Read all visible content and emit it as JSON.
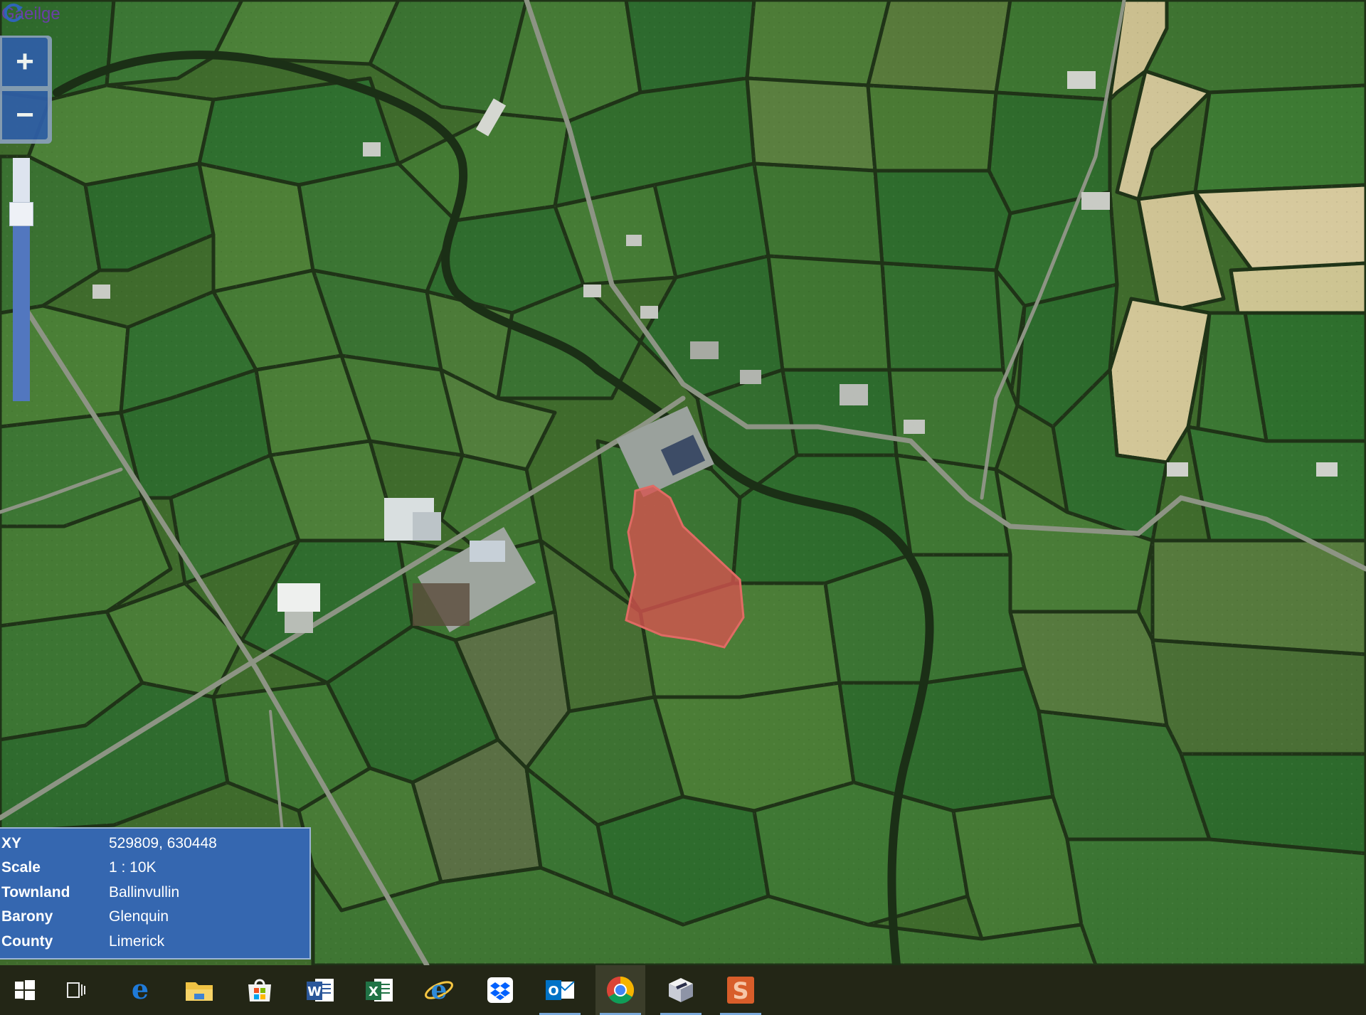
{
  "map": {
    "language_link": "Gaeilge",
    "zoom_in_label": "+",
    "zoom_out_label": "−",
    "zoom_level_fraction": 0.77,
    "imagery_color": "#3f6b2c",
    "highlight_color": "#d9534f"
  },
  "info": {
    "rows": [
      {
        "label": "XY",
        "value": "529809, 630448"
      },
      {
        "label": "Scale",
        "value": "1 : 10K"
      },
      {
        "label": "Townland",
        "value": "Ballinvullin"
      },
      {
        "label": "Barony",
        "value": "Glenquin"
      },
      {
        "label": "County",
        "value": "Limerick"
      }
    ]
  },
  "taskbar": {
    "items": [
      {
        "icon": "windows-start-icon"
      },
      {
        "icon": "task-view-icon"
      },
      {
        "icon": "edge-icon"
      },
      {
        "icon": "file-explorer-icon"
      },
      {
        "icon": "store-icon"
      },
      {
        "icon": "word-icon"
      },
      {
        "icon": "excel-icon"
      },
      {
        "icon": "internet-explorer-icon"
      },
      {
        "icon": "dropbox-icon"
      },
      {
        "icon": "outlook-icon"
      },
      {
        "icon": "chrome-icon"
      },
      {
        "icon": "box-app-icon"
      },
      {
        "icon": "snagit-icon"
      }
    ]
  }
}
